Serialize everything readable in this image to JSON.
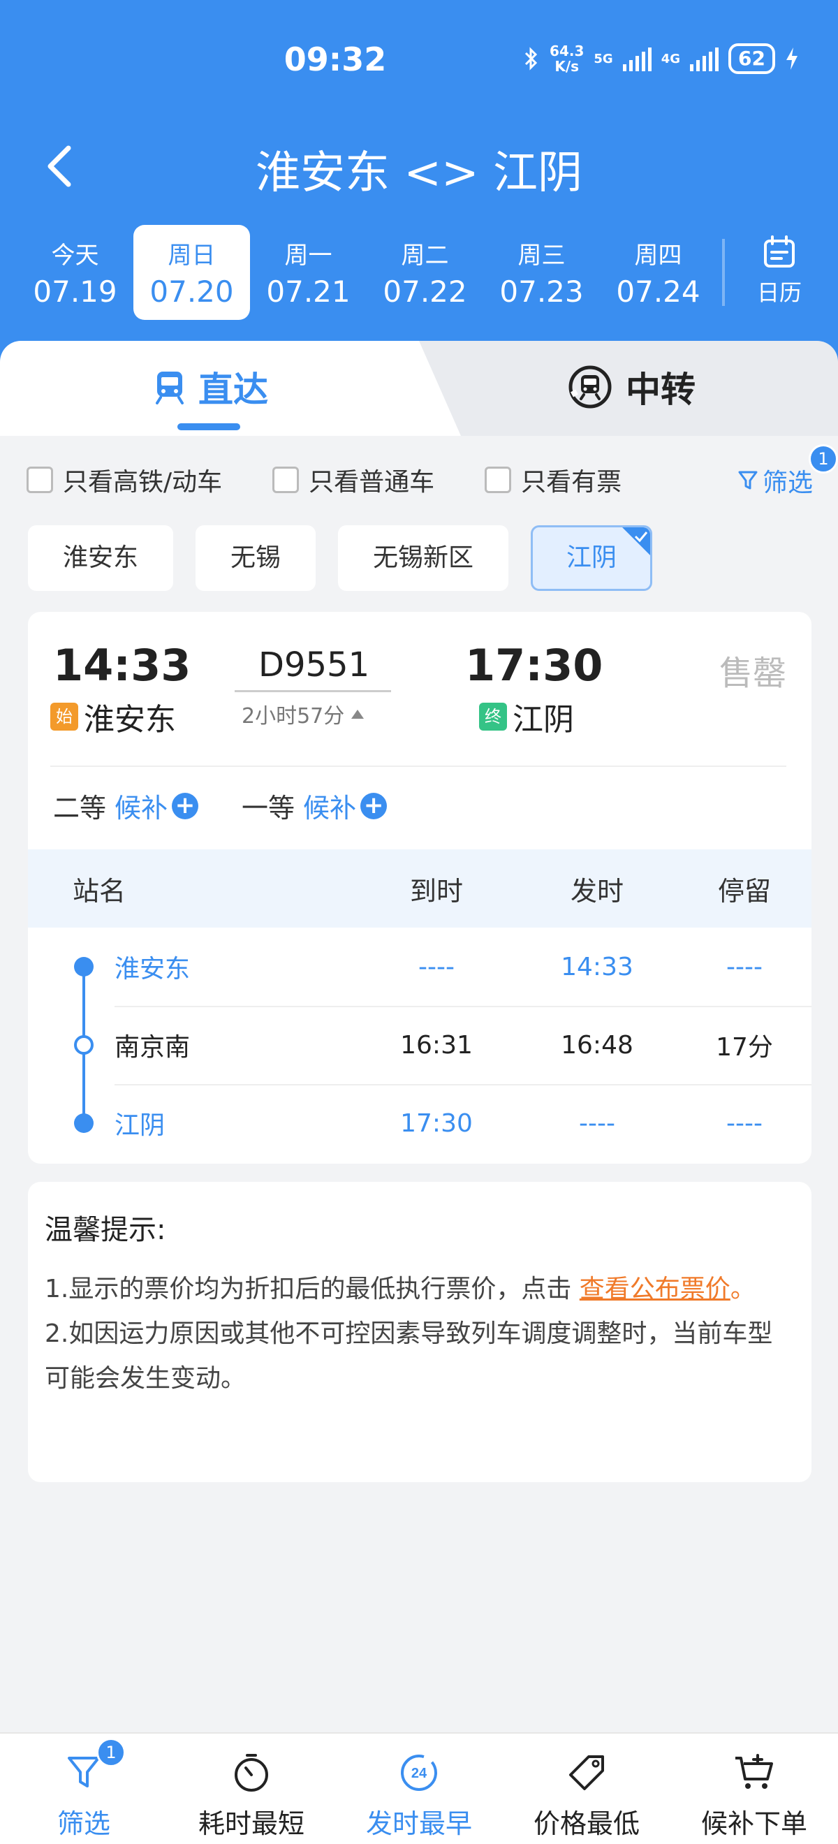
{
  "status_bar": {
    "time": "09:32",
    "speed_top": "64.3",
    "speed_bottom": "K/s",
    "net_5g": "5G",
    "net_4g": "4G",
    "battery": "62"
  },
  "header": {
    "title": "淮安东 <> 江阴"
  },
  "dates": [
    {
      "weekday": "今天",
      "date": "07.19"
    },
    {
      "weekday": "周日",
      "date": "07.20",
      "active": true
    },
    {
      "weekday": "周一",
      "date": "07.21"
    },
    {
      "weekday": "周二",
      "date": "07.22"
    },
    {
      "weekday": "周三",
      "date": "07.23"
    },
    {
      "weekday": "周四",
      "date": "07.24"
    }
  ],
  "calendar_label": "日历",
  "tabs": {
    "direct": "直达",
    "transfer": "中转"
  },
  "filters": {
    "high_speed": "只看高铁/动车",
    "normal": "只看普通车",
    "has_ticket": "只看有票",
    "filter_label": "筛选",
    "filter_badge": "1"
  },
  "stations": [
    "淮安东",
    "无锡",
    "无锡新区",
    "江阴"
  ],
  "selected_station": "江阴",
  "train": {
    "dep_time": "14:33",
    "arr_time": "17:30",
    "number": "D9551",
    "duration": "2小时57分",
    "status": "售罄",
    "start_tag": "始",
    "end_tag": "终",
    "dep_station": "淮安东",
    "arr_station": "江阴",
    "seats": [
      {
        "class": "二等",
        "action": "候补"
      },
      {
        "class": "一等",
        "action": "候补"
      }
    ]
  },
  "stop_table": {
    "headers": {
      "name": "站名",
      "arrive": "到时",
      "depart": "发时",
      "stay": "停留"
    },
    "rows": [
      {
        "name": "淮安东",
        "arrive": "----",
        "depart": "14:33",
        "stay": "----"
      },
      {
        "name": "南京南",
        "arrive": "16:31",
        "depart": "16:48",
        "stay": "17分"
      },
      {
        "name": "江阴",
        "arrive": "17:30",
        "depart": "----",
        "stay": "----"
      }
    ]
  },
  "tips": {
    "title": "温馨提示:",
    "line1_prefix": "1.显示的票价均为折扣后的最低执行票价，点击 ",
    "line1_link": "查看公布票价",
    "line1_suffix": "。",
    "line2": "2.如因运力原因或其他不可控因素导致列车调度调整时，当前车型可能会发生变动。"
  },
  "bottom_bar": {
    "filter": "筛选",
    "filter_badge": "1",
    "shortest": "耗时最短",
    "earliest": "发时最早",
    "earliest_icon_text": "24",
    "cheapest": "价格最低",
    "waitlist": "候补下单"
  },
  "colors": {
    "brand_blue": "#3a8ef0",
    "orange_link": "#f07a2a",
    "start_tag": "#f39a2b",
    "end_tag": "#34c386"
  }
}
